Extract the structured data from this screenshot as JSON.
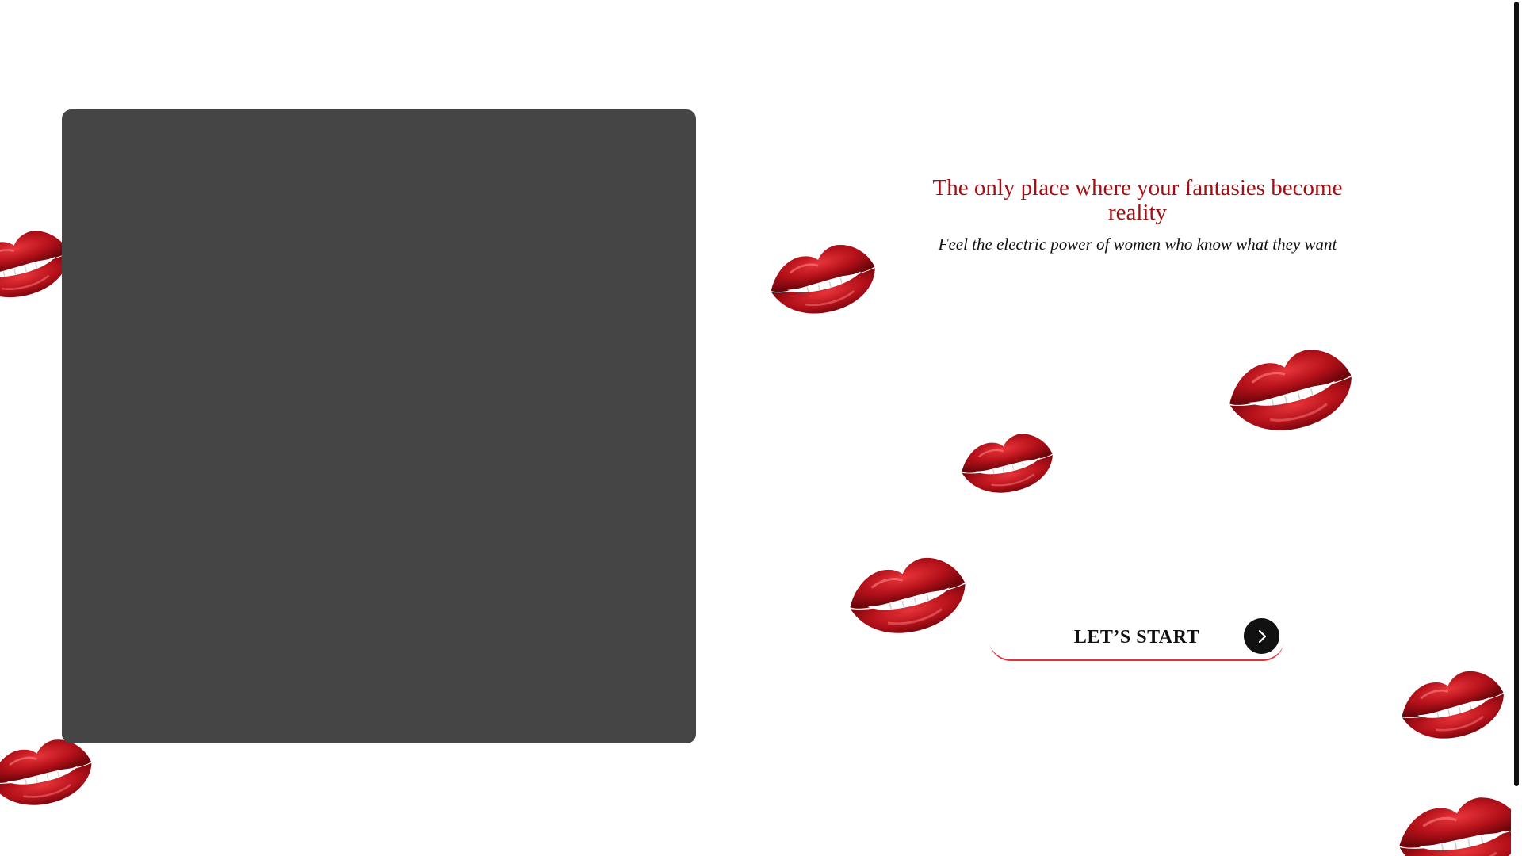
{
  "hero": {
    "title": "The only place where your fantasies become reality",
    "subtitle": "Feel the electric power of women who know what they want"
  },
  "cta": {
    "label": "LET’S START",
    "icon": "chevron-right-icon"
  },
  "colors": {
    "title": "#a30f12",
    "media_panel": "#454545",
    "lips_red": "#c0141b",
    "button_underline": "#e0323c",
    "arrow_circle": "#111111"
  },
  "decorations": {
    "icon": "red-lips-icon"
  }
}
